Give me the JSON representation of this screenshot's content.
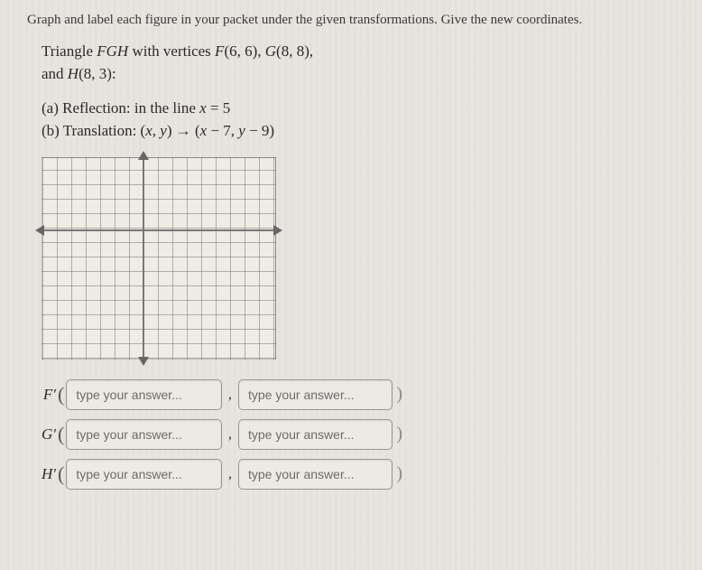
{
  "instructions": "Graph and label each figure in your packet under the given transformations. Give the new coordinates.",
  "problem": {
    "triangle_prefix": "Triangle ",
    "triangle_name": "FGH",
    "vertices_text_1": " with vertices ",
    "f_label": "F",
    "f_coords": "(6, 6), ",
    "g_label": "G",
    "g_coords": "(8, 8),",
    "line2_prefix": "and ",
    "h_label": "H",
    "h_coords": "(8, 3):",
    "part_a": "(a) Reflection: in the line ",
    "part_a_var": "x",
    "part_a_eq": " = 5",
    "part_b": "(b) Translation: (",
    "part_b_x": "x",
    "part_b_mid": ", ",
    "part_b_y": "y",
    "part_b_arrow": ") → (",
    "part_b_x2": "x",
    "part_b_minus7": " − 7, ",
    "part_b_y2": "y",
    "part_b_minus9": " − 9)"
  },
  "answers": {
    "rows": [
      {
        "label": "F′",
        "f1_val": "",
        "f2_val": ""
      },
      {
        "label": "G′",
        "f1_val": "",
        "f2_val": ""
      },
      {
        "label": "H′",
        "f1_val": "",
        "f2_val": ""
      }
    ],
    "placeholder": "type your answer..."
  }
}
